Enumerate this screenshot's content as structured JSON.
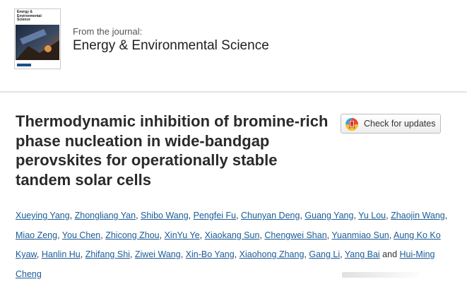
{
  "journal": {
    "cover_title": "Energy & Environmental Science",
    "from_label": "From the journal:",
    "name": "Energy & Environmental Science"
  },
  "article": {
    "title": "Thermodynamic inhibition of bromine-rich phase nucleation in wide-bandgap perovskites for operationally stable tandem solar cells"
  },
  "check_updates": {
    "label": "Check for updates"
  },
  "authors": [
    "Xueying Yang",
    "Zhongliang Yan",
    "Shibo Wang",
    "Pengfei Fu",
    "Chunyan Deng",
    "Guang Yang",
    "Yu Lou",
    "Zhaojin Wang",
    "Miao Zeng",
    "You Chen",
    "Zhicong Zhou",
    "XinYu Ye",
    "Xiaokang Sun",
    "Chengwei Shan",
    "Yuanmiao Sun",
    "Aung Ko Ko Kyaw",
    "Hanlin Hu",
    "Zhifang Shi",
    "Ziwei Wang",
    "Xin-Bo Yang",
    "Xiaohong Zhang",
    "Gang Li",
    "Yang Bai",
    "Hui-Ming Cheng"
  ],
  "authors_conjunction": "and",
  "colors": {
    "link": "#1b5b96",
    "divider": "#e4e4e4",
    "title": "#2a2a2a"
  },
  "icons": {
    "check_updates": "crossmark-bookmark-icon"
  }
}
